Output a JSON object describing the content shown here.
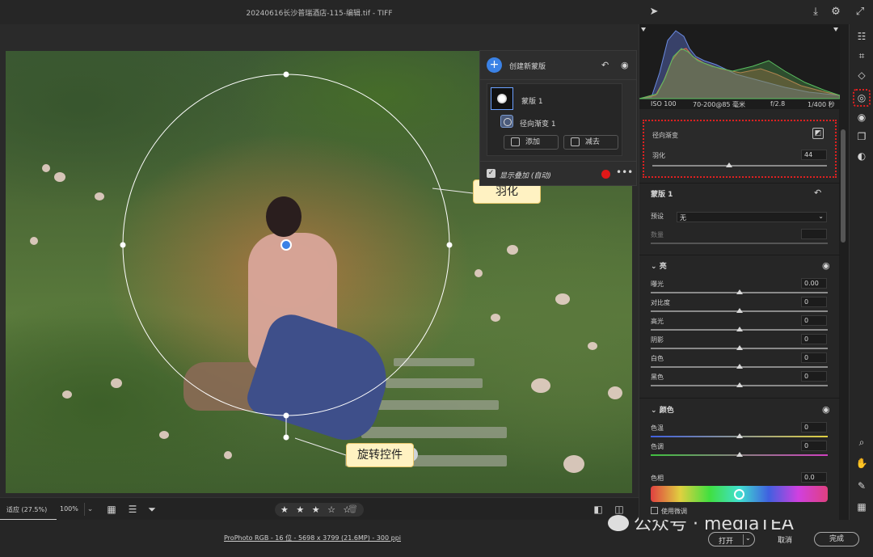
{
  "window": {
    "title": "20240616长沙普瑞酒店-115-编辑.tif  -  TIFF"
  },
  "colors": {
    "accent_blue": "#3b82e6",
    "highlight_red": "#e02020",
    "callout_bg": "#fff2c2",
    "overlay_dot": "#e01818"
  },
  "title_icons": [
    "download-icon",
    "gear-icon",
    "expand-icon"
  ],
  "mask_panel": {
    "create_label": "创建新蒙版",
    "mask_name": "蒙版 1",
    "sub_mask_name": "径向渐变 1",
    "add_label": "添加",
    "subtract_label": "减去",
    "overlay_label": "显示叠加 (自动)",
    "more": "•••"
  },
  "callouts": {
    "feather": "羽化",
    "rotate": "旋转控件"
  },
  "bottom_bar": {
    "fit_label": "适应 (27.5%)",
    "zoom_label": "100%",
    "zoom_chevron": "⌄",
    "stars": "★ ★ ★ ☆ ☆",
    "trash": "🗑"
  },
  "status": {
    "file_info": "ProPhoto RGB - 16 位 - 5698 x 3799 (21.6MP) - 300 ppi",
    "open_label": "打开",
    "open_chevron": "⌄",
    "cancel_label": "取消",
    "done_label": "完成"
  },
  "watermark": "公众号 · mediaTEA",
  "exif": {
    "iso": "ISO 100",
    "lens": "70-200@85 毫米",
    "aperture": "f/2.8",
    "shutter": "1/400 秒"
  },
  "radial_section": {
    "title": "径向渐变",
    "feather_label": "羽化",
    "feather_value": "44",
    "feather_level": 0.44
  },
  "mask_section": {
    "title": "蒙版 1",
    "preset_label": "预设",
    "preset_value": "无",
    "amount_label": "数量"
  },
  "light_section": {
    "title": "亮",
    "sliders": [
      {
        "label": "曝光",
        "value": "0.00"
      },
      {
        "label": "对比度",
        "value": "0"
      },
      {
        "label": "高光",
        "value": "0"
      },
      {
        "label": "阴影",
        "value": "0"
      },
      {
        "label": "白色",
        "value": "0"
      },
      {
        "label": "黑色",
        "value": "0"
      }
    ]
  },
  "color_section": {
    "title": "颜色",
    "temp_label": "色温",
    "temp_value": "0",
    "tint_label": "色调",
    "tint_value": "0",
    "hue_label": "色相",
    "hue_value": "0.0",
    "use_fine_label": "使用微调"
  },
  "tools": [
    "sliders-icon",
    "crop-icon",
    "eraser-icon",
    "mask-icon",
    "eye-icon",
    "layers-icon",
    "presets-icon",
    "zoom-icon",
    "hand-icon",
    "eyedropper-icon",
    "grid-icon"
  ]
}
